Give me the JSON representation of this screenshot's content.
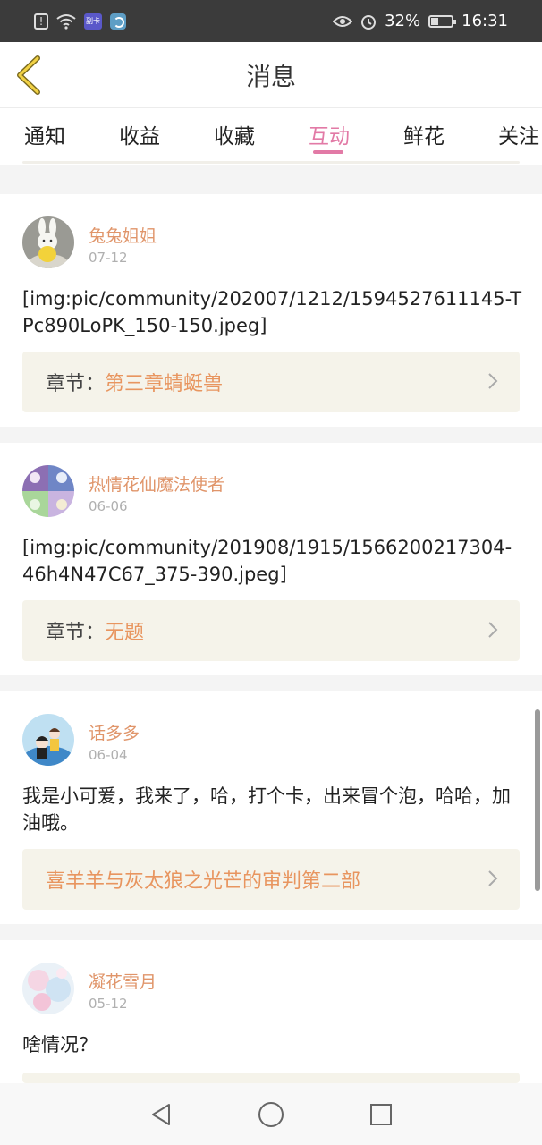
{
  "status_bar": {
    "battery_percent": "32%",
    "time": "16:31",
    "hd_badge": "副卡"
  },
  "header": {
    "title": "消息"
  },
  "tabs": [
    {
      "label": "通知"
    },
    {
      "label": "收益"
    },
    {
      "label": "收藏"
    },
    {
      "label": "互动",
      "active": true
    },
    {
      "label": "鲜花"
    },
    {
      "label": "关注"
    }
  ],
  "items": [
    {
      "user": "兔兔姐姐",
      "date": "07-12",
      "content": "[img:pic/community/202007/1212/1594527611145-TPc890LoPK_150-150.jpeg]",
      "chapter_label": "章节：",
      "chapter_value": "第三章蜻蜓兽"
    },
    {
      "user": "热情花仙魔法使者",
      "date": "06-06",
      "content": "[img:pic/community/201908/1915/1566200217304-46h4N47C67_375-390.jpeg]",
      "chapter_label": "章节：",
      "chapter_value": "无题"
    },
    {
      "user": "话多多",
      "date": "06-04",
      "content": "我是小可爱，我来了，哈，打个卡，出来冒个泡，哈哈，加油哦。",
      "chapter_label": "",
      "chapter_value": "喜羊羊与灰太狼之光芒的审判第二部"
    },
    {
      "user": "凝花雪月",
      "date": "05-12",
      "content": "啥情况？"
    }
  ],
  "colors": {
    "accent_pink": "#e27aa6",
    "username_orange": "#e0956a",
    "chapter_orange": "#e8955f",
    "chapter_bg": "#f5f3ea"
  }
}
